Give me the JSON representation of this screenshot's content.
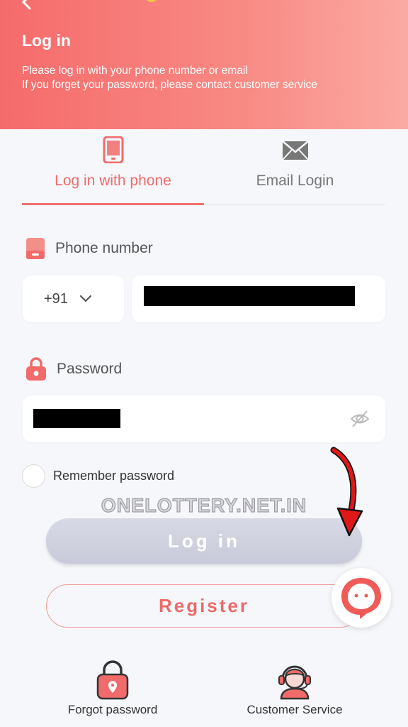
{
  "header": {
    "title": "Log in",
    "desc_line1": "Please log in with your phone number or email",
    "desc_line2": "If you forget your password, please contact customer service"
  },
  "tabs": [
    {
      "label": "Log in with phone",
      "icon": "phone-icon",
      "active": true
    },
    {
      "label": "Email Login",
      "icon": "mail-icon",
      "active": false
    }
  ],
  "phone": {
    "label": "Phone number",
    "country_code": "+91"
  },
  "password": {
    "label": "Password"
  },
  "remember": {
    "label": "Remember password"
  },
  "watermark": "ONELOTTERY.NET.IN",
  "buttons": {
    "login": "Log in",
    "register": "Register"
  },
  "footer": {
    "forgot": "Forgot password",
    "service": "Customer Service"
  },
  "colors": {
    "accent": "#f26b6b",
    "header_start": "#f56b6b",
    "header_end": "#fbaaa3",
    "login_button": "#d2d4e2"
  }
}
